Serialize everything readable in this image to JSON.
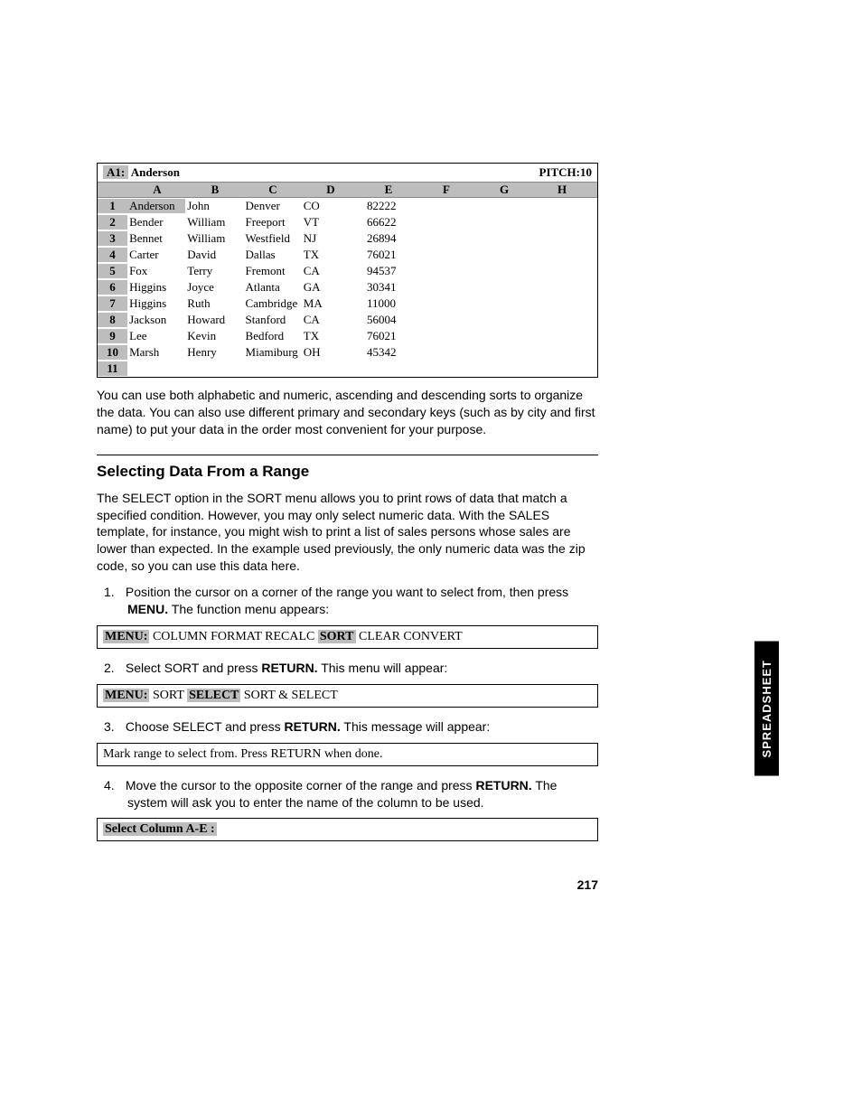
{
  "spreadsheet": {
    "cellref_label": "A1:",
    "cellref_value": "Anderson",
    "pitch": "PITCH:10",
    "columns": [
      "A",
      "B",
      "C",
      "D",
      "E",
      "F",
      "G",
      "H"
    ],
    "rows": [
      {
        "n": "1",
        "a": "Anderson",
        "b": "John",
        "c": "Denver",
        "d": "CO",
        "e": "82222",
        "hlA": true
      },
      {
        "n": "2",
        "a": "Bender",
        "b": "William",
        "c": "Freeport",
        "d": "VT",
        "e": "66622"
      },
      {
        "n": "3",
        "a": "Bennet",
        "b": "William",
        "c": "Westfield",
        "d": "NJ",
        "e": "26894"
      },
      {
        "n": "4",
        "a": "Carter",
        "b": "David",
        "c": "Dallas",
        "d": "TX",
        "e": "76021"
      },
      {
        "n": "5",
        "a": "Fox",
        "b": "Terry",
        "c": "Fremont",
        "d": "CA",
        "e": "94537"
      },
      {
        "n": "6",
        "a": "Higgins",
        "b": "Joyce",
        "c": "Atlanta",
        "d": "GA",
        "e": "30341"
      },
      {
        "n": "7",
        "a": "Higgins",
        "b": "Ruth",
        "c": "Cambridge",
        "d": "MA",
        "e": "11000"
      },
      {
        "n": "8",
        "a": "Jackson",
        "b": "Howard",
        "c": "Stanford",
        "d": "CA",
        "e": "56004"
      },
      {
        "n": "9",
        "a": "Lee",
        "b": "Kevin",
        "c": "Bedford",
        "d": "TX",
        "e": "76021"
      },
      {
        "n": "10",
        "a": "Marsh",
        "b": "Henry",
        "c": "Miamiburg",
        "d": "OH",
        "e": "45342"
      },
      {
        "n": "11",
        "a": "",
        "b": "",
        "c": "",
        "d": "",
        "e": ""
      }
    ]
  },
  "paras": {
    "p1": "You can use both alphabetic and numeric, ascending and descending sorts to organize the data. You can also use different primary and secondary keys (such as by city and first name) to put your data in the order most convenient for your purpose.",
    "section_title": "Selecting Data From a Range",
    "p2": "The SELECT option in the SORT menu allows you to print rows of data that match a specified condition. However, you may only select numeric data. With the SALES template, for instance, you might wish to print a list of sales persons whose sales are lower than expected. In the example used previously, the only numeric data was the zip code, so you can use this data here."
  },
  "steps": {
    "s1a": "Position the cursor on a corner of the range you want to select from, then press ",
    "s1b": "MENU.",
    "s1c": " The function menu appears:",
    "s2a": "Select SORT and press ",
    "s2b": "RETURN.",
    "s2c": " This menu will appear:",
    "s3a": "Choose SELECT and press ",
    "s3b": "RETURN.",
    "s3c": " This message will appear:",
    "s4a": "Move the cursor to the opposite corner of the range and press ",
    "s4b": "RETURN.",
    "s4c": " The system will ask you to enter the name of the column to be used."
  },
  "menus": {
    "m1_label": "MENU:",
    "m1_items": " COLUMN FORMAT  RECALC ",
    "m1_hl": "SORT",
    "m1_rest": "  CLEAR  CONVERT",
    "m2_label": "MENU:",
    "m2_items": " SORT ",
    "m2_hl": "SELECT",
    "m2_rest": "  SORT & SELECT",
    "m3": "Mark range to select from.  Press RETURN when done.",
    "m4_hl": "Select Column A-E :"
  },
  "sidetab": "SPREADSHEET",
  "pagenum": "217"
}
